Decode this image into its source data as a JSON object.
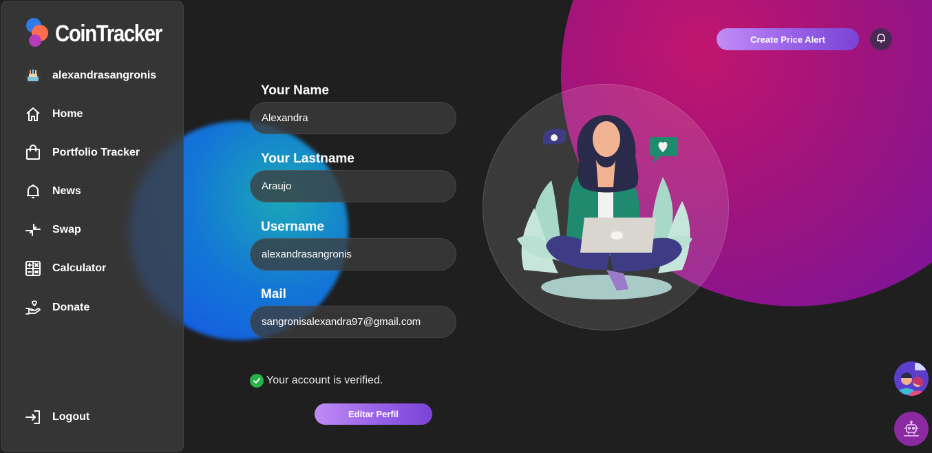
{
  "brand": {
    "name": "CoinTracker",
    "logo_icon": "cointracker-logo"
  },
  "sidebar": {
    "items": [
      {
        "label": "alexandrasangronis",
        "icon": "user-avatar-icon"
      },
      {
        "label": "Home",
        "icon": "home-icon"
      },
      {
        "label": "Portfolio Tracker",
        "icon": "shopping-bag-icon"
      },
      {
        "label": "News",
        "icon": "bell-icon"
      },
      {
        "label": "Swap",
        "icon": "swap-arrows-icon"
      },
      {
        "label": "Calculator",
        "icon": "calculator-icon"
      },
      {
        "label": "Donate",
        "icon": "hand-heart-icon"
      }
    ],
    "logout": {
      "label": "Logout",
      "icon": "logout-icon"
    }
  },
  "header": {
    "create_alert_label": "Create Price Alert",
    "notification_icon": "bell-icon"
  },
  "form": {
    "name": {
      "label": "Your Name",
      "value": "Alexandra"
    },
    "lastname": {
      "label": "Your Lastname",
      "value": "Araujo"
    },
    "username": {
      "label": "Username",
      "value": "alexandrasangronis"
    },
    "mail": {
      "label": "Mail",
      "value": "sangronisalexandra97@gmail.com"
    },
    "verified_text": "Your account is verified.",
    "edit_button_label": "Editar Perfil"
  },
  "colors": {
    "background": "#1f1f1f",
    "accent_purple": "#9b64e8",
    "verified_green": "#27b24a",
    "blob_pink": "#c0156e",
    "blob_blue": "#1376d6"
  }
}
